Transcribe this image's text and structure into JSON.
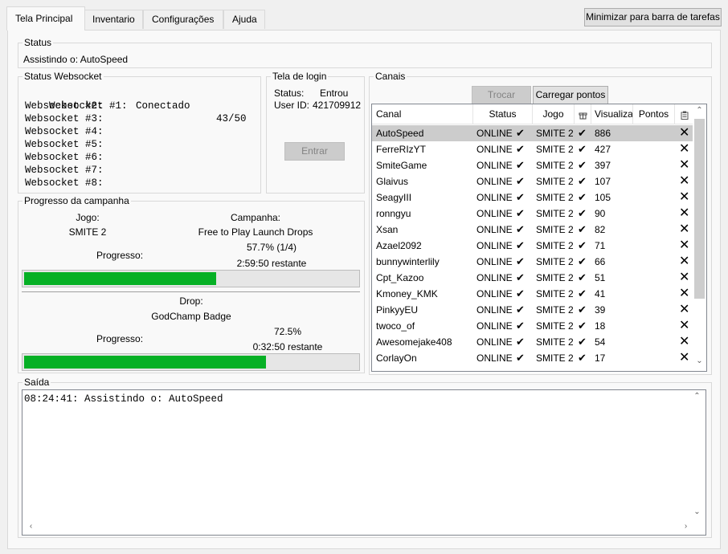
{
  "tabs": [
    {
      "label": "Tela Principal",
      "active": true
    },
    {
      "label": "Inventario",
      "active": false
    },
    {
      "label": "Configurações",
      "active": false
    },
    {
      "label": "Ajuda",
      "active": false
    }
  ],
  "minimize_button": "Minimizar para barra de tarefas",
  "status": {
    "title": "Status",
    "text": "Assistindo o: AutoSpeed"
  },
  "websocket": {
    "title": "Status Websocket",
    "count": "43/50",
    "rows": [
      {
        "label": "Websocket #1:",
        "state": "Conectado"
      },
      {
        "label": "Websocket #2:",
        "state": ""
      },
      {
        "label": "Websocket #3:",
        "state": ""
      },
      {
        "label": "Websocket #4:",
        "state": ""
      },
      {
        "label": "Websocket #5:",
        "state": ""
      },
      {
        "label": "Websocket #6:",
        "state": ""
      },
      {
        "label": "Websocket #7:",
        "state": ""
      },
      {
        "label": "Websocket #8:",
        "state": ""
      }
    ]
  },
  "login": {
    "title": "Tela de login",
    "status_label": "Status:",
    "status_value": "Entrou",
    "user_label": "User ID:",
    "user_value": "421709912",
    "button": "Entrar"
  },
  "campaign": {
    "title": "Progresso da campanha",
    "game_label": "Jogo:",
    "game_value": "SMITE 2",
    "campaign_label": "Campanha:",
    "campaign_value": "Free to Play Launch Drops",
    "progress_label": "Progresso:",
    "campaign_percent": "57.7% (1/4)",
    "campaign_remaining": "2:59:50 restante",
    "campaign_progress": 0.577,
    "drop_label": "Drop:",
    "drop_value": "GodChamp Badge",
    "drop_progress_label": "Progresso:",
    "drop_percent": "72.5%",
    "drop_remaining": "0:32:50 restante",
    "drop_progress": 0.725
  },
  "channels": {
    "title": "Canais",
    "switch_button": "Trocar",
    "load_points_button": "Carregar pontos",
    "headers": [
      "Canal",
      "Status",
      "Jogo",
      "",
      "Visualiza",
      "Pontos",
      ""
    ],
    "rows": [
      {
        "name": "AutoSpeed",
        "status": "ONLINE",
        "game": "SMITE 2",
        "viewers": "886"
      },
      {
        "name": "FerreRIzYT",
        "status": "ONLINE",
        "game": "SMITE 2",
        "viewers": "427"
      },
      {
        "name": "SmiteGame",
        "status": "ONLINE",
        "game": "SMITE 2",
        "viewers": "397"
      },
      {
        "name": "Glaivus",
        "status": "ONLINE",
        "game": "SMITE 2",
        "viewers": "107"
      },
      {
        "name": "SeagyIII",
        "status": "ONLINE",
        "game": "SMITE 2",
        "viewers": "105"
      },
      {
        "name": "ronngyu",
        "status": "ONLINE",
        "game": "SMITE 2",
        "viewers": "90"
      },
      {
        "name": "Xsan",
        "status": "ONLINE",
        "game": "SMITE 2",
        "viewers": "82"
      },
      {
        "name": "Azael2092",
        "status": "ONLINE",
        "game": "SMITE 2",
        "viewers": "71"
      },
      {
        "name": "bunnywinterlily",
        "status": "ONLINE",
        "game": "SMITE 2",
        "viewers": "66"
      },
      {
        "name": "Cpt_Kazoo",
        "status": "ONLINE",
        "game": "SMITE 2",
        "viewers": "51"
      },
      {
        "name": "Kmoney_KMK",
        "status": "ONLINE",
        "game": "SMITE 2",
        "viewers": "41"
      },
      {
        "name": "PinkyyEU",
        "status": "ONLINE",
        "game": "SMITE 2",
        "viewers": "39"
      },
      {
        "name": "twoco_of",
        "status": "ONLINE",
        "game": "SMITE 2",
        "viewers": "18"
      },
      {
        "name": "Awesomejake408",
        "status": "ONLINE",
        "game": "SMITE 2",
        "viewers": "54"
      },
      {
        "name": "CorlayOn",
        "status": "ONLINE",
        "game": "SMITE 2",
        "viewers": "17"
      }
    ]
  },
  "output": {
    "title": "Saída",
    "text": "08:24:41: Assistindo o: AutoSpeed"
  },
  "icons": {
    "check": "check-icon",
    "remove": "close-icon",
    "gift": "gift-icon",
    "clipboard": "clipboard-icon"
  },
  "colors": {
    "progress_fill": "#06b025",
    "selected_row": "#cccccc"
  }
}
